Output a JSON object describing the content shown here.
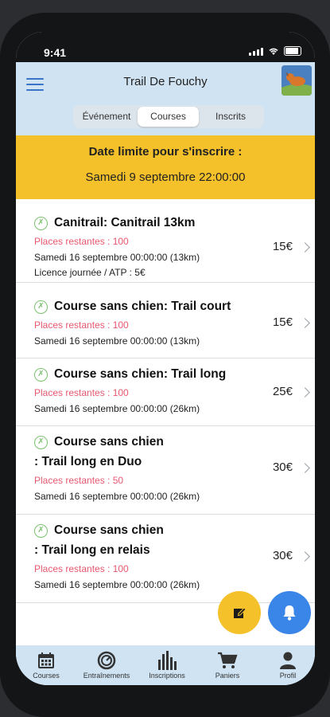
{
  "status": {
    "time": "9:41"
  },
  "header": {
    "title": "Trail De Fouchy"
  },
  "tabs": [
    "Événement",
    "Courses",
    "Inscrits"
  ],
  "banner": {
    "heading": "Date limite pour s'inscrire :",
    "date": "Samedi 9 septembre 22:00:00"
  },
  "courses": [
    {
      "name": "Canitrail: Canitrail 13km",
      "places": "Places restantes : 100",
      "date": "Samedi 16 septembre 00:00:00 (13km)",
      "extra": "Licence journée / ATP : 5€",
      "price": "15€"
    },
    {
      "name": "Course sans chien: Trail court",
      "places": "Places restantes : 100",
      "date": "Samedi 16 septembre 00:00:00 (13km)",
      "price": "15€"
    },
    {
      "name": "Course sans chien: Trail long",
      "places": "Places restantes : 100",
      "date": "Samedi 16 septembre 00:00:00 (26km)",
      "price": "25€"
    },
    {
      "name_line1": "Course sans chien",
      "name_line2": ": Trail long en Duo",
      "places": "Places restantes : 50",
      "date": "Samedi 16 septembre 00:00:00 (26km)",
      "price": "30€"
    },
    {
      "name_line1": "Course sans chien",
      "name_line2": ": Trail long en relais",
      "places": "Places restantes : 100",
      "date": "Samedi 16 septembre 00:00:00 (26km)",
      "price": "30€"
    }
  ],
  "tabbar": [
    "Courses",
    "Entraînements",
    "Inscriptions",
    "Paniers",
    "Profil"
  ],
  "colors": {
    "header": "#cfe3f2",
    "banner": "#f5c12a",
    "places": "#e8586f",
    "fab_edit": "#f5c12a",
    "fab_bell": "#3a86e8"
  }
}
